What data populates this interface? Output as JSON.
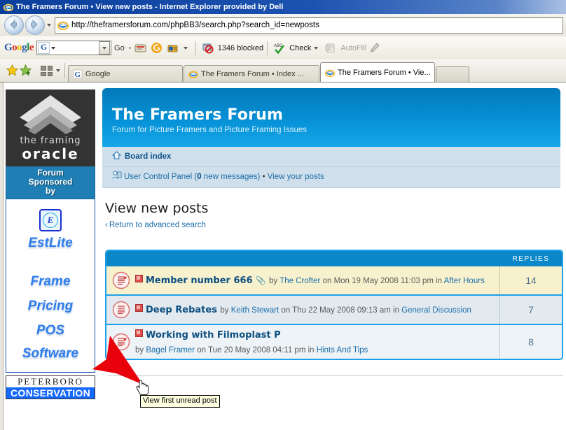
{
  "window": {
    "title": "The Framers Forum • View new posts - Internet Explorer provided by Dell",
    "icon": "ie-icon"
  },
  "addressbar": {
    "url": "http://theframersforum.com/phpBB3/search.php?search_id=newposts",
    "back_icon": "back-arrow-icon",
    "forward_icon": "forward-arrow-icon",
    "dropdown_icon": "chevron-down-icon",
    "page_icon": "ie-page-icon"
  },
  "google_toolbar": {
    "logo_letters": [
      "G",
      "o",
      "o",
      "g",
      "l",
      "e"
    ],
    "search_value": "",
    "search_prefix": "G",
    "go_label": "Go",
    "blocked_label": "1346 blocked",
    "check_label": "Check",
    "autofill_label": "AutoFill",
    "icons": [
      "bookmarks-icon",
      "gmail-icon",
      "settings-icon",
      "popup-blocker-icon",
      "spellcheck-icon",
      "autofill-icon",
      "highlight-icon"
    ]
  },
  "tabbar": {
    "favorites_icon": "star-icon",
    "add_favorite_icon": "add-star-icon",
    "quick_tabs_icon": "quick-tabs-icon",
    "tabs": [
      {
        "label": "Google",
        "icon": "google-favicon",
        "active": false,
        "closable": false
      },
      {
        "label": "The Framers Forum • Index ...",
        "icon": "ie-favicon",
        "active": false,
        "closable": false
      },
      {
        "label": "The Framers Forum • Vie...",
        "icon": "ie-favicon",
        "active": true,
        "closable": true,
        "close_label": "✕"
      }
    ],
    "new_tab_label": ""
  },
  "sidebar": {
    "oracle_ad": {
      "line1": "the framing",
      "line2": "oracle",
      "chevron_icon": "chevron-up-logo"
    },
    "sponsor_banner": {
      "line1": "Forum",
      "line2": "Sponsored",
      "line3": "by"
    },
    "estlite_ad": {
      "badge_letter": "E",
      "name": "EstLite",
      "lines": [
        "Frame",
        "Pricing",
        "POS",
        "Software"
      ]
    },
    "peterboro_ad": {
      "top": "PETERBORO",
      "bottom": "CONSERVATION"
    }
  },
  "forum": {
    "header": {
      "title": "The Framers Forum",
      "subtitle": "Forum for Picture Framers and Picture Framing Issues"
    },
    "breadcrumb": {
      "home_icon": "home-icon",
      "label": "Board index"
    },
    "userbar": {
      "user_icon": "user-icon",
      "ucp_label": "User Control Panel",
      "new_messages_count": "0",
      "new_messages_suffix": " new messages",
      "separator": "•",
      "view_posts_label": "View your posts"
    },
    "page_title": "View new posts",
    "return_link": "Return to advanced search",
    "return_link_arrow": "‹",
    "table": {
      "columns": [
        "",
        "REPLIES"
      ],
      "rows": [
        {
          "icon": "unread-post-icon-starred",
          "subject": "Member number 666",
          "attachment_icon": "paperclip-icon",
          "author": "The Crofter",
          "by_label": "by",
          "on_label": "on",
          "date": "Mon 19 May 2008 11:03 pm",
          "in_label": "in",
          "forum": "After Hours",
          "replies": "14",
          "highlight": true
        },
        {
          "icon": "read-post-icon",
          "subject": "Deep Rebates",
          "attachment_icon": "",
          "author": "Keith Stewart",
          "by_label": "by",
          "on_label": "on",
          "date": "Thu 22 May 2008 09:13 am",
          "in_label": "in",
          "forum": "General Discussion",
          "replies": "7",
          "highlight": false
        },
        {
          "icon": "unread-post-icon-starred",
          "subject": "Working with Filmoplast P",
          "attachment_icon": "",
          "author": "Bagel Framer",
          "by_label": "by",
          "on_label": "on",
          "date": "Tue 20 May 2008 04:11 pm",
          "in_label": "in",
          "forum": "Hints And Tips",
          "replies": "8",
          "highlight": false
        }
      ]
    }
  },
  "overlays": {
    "tooltip_text": "View first unread post",
    "arrow_annotation_color": "#e8000b",
    "cursor_icon": "hand-pointer-cursor"
  },
  "colors": {
    "titlebar_blue": "#0b3f9c",
    "forum_header_blue": "#0791d6",
    "table_border_blue": "#1da1e8",
    "table_head_blue": "#0a87c9",
    "link_blue": "#1b6ca8",
    "subject_blue": "#0d4f80",
    "highlight_row": "#f7f2cd"
  }
}
